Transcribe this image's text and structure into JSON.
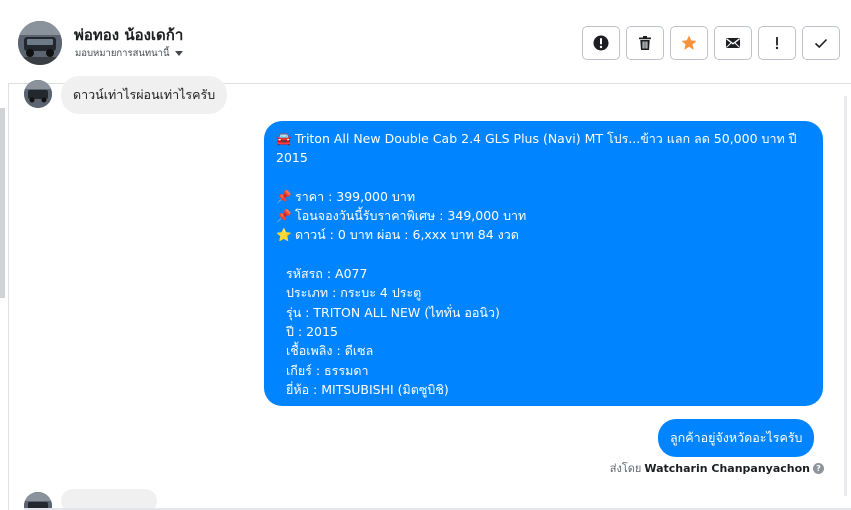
{
  "header": {
    "name": "พ่อทอง น้องเดก้า",
    "assign_label": "มอบหมายการสนทนานี้"
  },
  "actions": [
    {
      "name": "alert-circle",
      "icon": "exclamation-circle-icon"
    },
    {
      "name": "delete",
      "icon": "trash-icon"
    },
    {
      "name": "star",
      "icon": "star-icon"
    },
    {
      "name": "mark-unread",
      "icon": "envelope-icon"
    },
    {
      "name": "important",
      "icon": "exclamation-icon"
    },
    {
      "name": "done",
      "icon": "check-icon"
    }
  ],
  "messages": {
    "incoming_1": "ดาวน์เท่าไรผ่อนเท่าไรครับ",
    "outgoing_big": {
      "title_emoji": "🚘",
      "title": "Triton All New Double Cab 2.4 GLS Plus (Navi) MT โปร...ข้าว แลก ลด 50,000 บาท ปี",
      "title_line2": "2015",
      "price_emoji": "📌",
      "price": "ราคา : 399,000 บาท",
      "promo_emoji": "📌",
      "promo": "โอนจองวันนี้รับราคาพิเศษ : 349,000 บาท",
      "down_emoji": "⭐",
      "down": "ดาวน์ : 0 บาท ผ่อน : 6,xxx บาท 84 งวด",
      "code": "รหัสรถ : A077",
      "type": "ประเภท : กระบะ 4 ประตู",
      "model": "รุ่น : TRITON ALL NEW (ไททั่น ออนิว)",
      "year": "ปี : 2015",
      "fuel": "เชื้อเพลิง : ดีเซล",
      "gear": "เกียร์ : ธรรมดา",
      "brand": "ยี่ห้อ : MITSUBISHI (มิตซูบิชิ)"
    },
    "outgoing_small": "ลูกค้าอยู่จังหวัดอะไรครับ",
    "sent_by_prefix": "ส่งโดย",
    "sent_by_name": "Watcharin Chanpanyachon"
  },
  "colors": {
    "outgoing_bubble": "#0084ff",
    "incoming_bubble": "#f1f0f0",
    "star": "#f7923b"
  }
}
